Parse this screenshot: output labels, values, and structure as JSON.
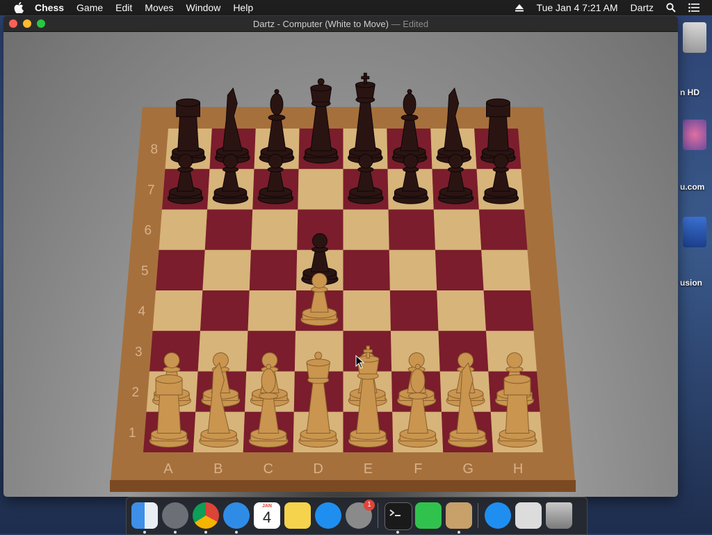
{
  "menubar": {
    "app": "Chess",
    "menus": [
      "Game",
      "Edit",
      "Moves",
      "Window",
      "Help"
    ],
    "clock": "Tue Jan 4  7:21 AM",
    "user": "Dartz"
  },
  "desktop": {
    "icons": [
      {
        "label": "n HD"
      },
      {
        "label": "u.com"
      },
      {
        "label": "usion"
      }
    ]
  },
  "window": {
    "title": "Dartz - Computer   (White to Move)",
    "edited": " — Edited"
  },
  "board": {
    "files": [
      "A",
      "B",
      "C",
      "D",
      "E",
      "F",
      "G",
      "H"
    ],
    "ranks": [
      "8",
      "7",
      "6",
      "5",
      "4",
      "3",
      "2",
      "1"
    ],
    "colors": {
      "light": "#d7b47a",
      "dark": "#7b1d2c",
      "frame": "#a6703c",
      "white_piece": "#c9954f",
      "black_piece": "#2a1412"
    },
    "pieces": [
      {
        "sq": "a8",
        "type": "rook",
        "color": "black"
      },
      {
        "sq": "b8",
        "type": "knight",
        "color": "black"
      },
      {
        "sq": "c8",
        "type": "bishop",
        "color": "black"
      },
      {
        "sq": "d8",
        "type": "queen",
        "color": "black"
      },
      {
        "sq": "e8",
        "type": "king",
        "color": "black"
      },
      {
        "sq": "f8",
        "type": "bishop",
        "color": "black"
      },
      {
        "sq": "g8",
        "type": "knight",
        "color": "black"
      },
      {
        "sq": "h8",
        "type": "rook",
        "color": "black"
      },
      {
        "sq": "a7",
        "type": "pawn",
        "color": "black"
      },
      {
        "sq": "b7",
        "type": "pawn",
        "color": "black"
      },
      {
        "sq": "c7",
        "type": "pawn",
        "color": "black"
      },
      {
        "sq": "e7",
        "type": "pawn",
        "color": "black"
      },
      {
        "sq": "f7",
        "type": "pawn",
        "color": "black"
      },
      {
        "sq": "g7",
        "type": "pawn",
        "color": "black"
      },
      {
        "sq": "h7",
        "type": "pawn",
        "color": "black"
      },
      {
        "sq": "d5",
        "type": "pawn",
        "color": "black"
      },
      {
        "sq": "d4",
        "type": "pawn",
        "color": "white"
      },
      {
        "sq": "a2",
        "type": "pawn",
        "color": "white"
      },
      {
        "sq": "b2",
        "type": "pawn",
        "color": "white"
      },
      {
        "sq": "c2",
        "type": "pawn",
        "color": "white"
      },
      {
        "sq": "e2",
        "type": "pawn",
        "color": "white"
      },
      {
        "sq": "f2",
        "type": "pawn",
        "color": "white"
      },
      {
        "sq": "g2",
        "type": "pawn",
        "color": "white"
      },
      {
        "sq": "h2",
        "type": "pawn",
        "color": "white"
      },
      {
        "sq": "a1",
        "type": "rook",
        "color": "white"
      },
      {
        "sq": "b1",
        "type": "knight",
        "color": "white"
      },
      {
        "sq": "c1",
        "type": "bishop",
        "color": "white"
      },
      {
        "sq": "d1",
        "type": "queen",
        "color": "white"
      },
      {
        "sq": "e1",
        "type": "king",
        "color": "white"
      },
      {
        "sq": "f1",
        "type": "bishop",
        "color": "white"
      },
      {
        "sq": "g1",
        "type": "knight",
        "color": "white"
      },
      {
        "sq": "h1",
        "type": "rook",
        "color": "white"
      }
    ]
  },
  "dock": {
    "calendar": {
      "month": "JAN",
      "day": "4"
    },
    "system_prefs_badge": "1",
    "items": [
      {
        "name": "finder-icon",
        "color": "#3d8fe8"
      },
      {
        "name": "launchpad-icon",
        "color": "#6c6f75"
      },
      {
        "name": "chrome-icon",
        "color": "#e8e8e8"
      },
      {
        "name": "safari-icon",
        "color": "#2f8ce6"
      },
      {
        "name": "calendar-icon",
        "color": "#ffffff"
      },
      {
        "name": "notes-icon",
        "color": "#f5d34c"
      },
      {
        "name": "app-store-icon",
        "color": "#1e8ff0"
      },
      {
        "name": "system-preferences-icon",
        "color": "#8a8a8a"
      },
      {
        "name": "terminal-icon",
        "color": "#1a1a1a"
      },
      {
        "name": "facetime-icon",
        "color": "#31c24d"
      },
      {
        "name": "chess-icon",
        "color": "#c7a06a"
      },
      {
        "name": "app-store-downloads-icon",
        "color": "#1e8ff0"
      },
      {
        "name": "document-icon",
        "color": "#dcdcdc"
      },
      {
        "name": "trash-icon",
        "color": "#9b9b9b"
      }
    ]
  }
}
